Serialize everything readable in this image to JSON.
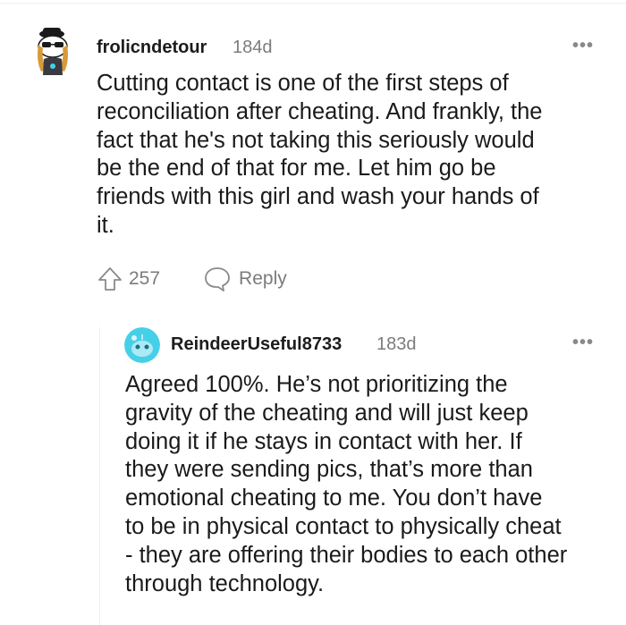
{
  "comment": {
    "username": "frolicndetour",
    "age": "184d",
    "more_label": "•••",
    "body_lines": [
      "Cutting contact is one of the first steps of",
      "reconciliation after cheating. And frankly, the",
      "fact that he's not taking this seriously would",
      "be the end of that for me. Let him go be",
      "friends with this girl and wash your hands of",
      "it."
    ],
    "upvotes": "257",
    "reply_label": "Reply",
    "avatar_icon": "snoo-avatar-sunglasses-icon"
  },
  "reply": {
    "username": "ReindeerUseful8733",
    "age": "183d",
    "more_label": "•••",
    "body_lines": [
      "Agreed 100%. He’s not prioritizing the",
      "gravity of the cheating and will just keep",
      "doing it if he stays in contact with her. If",
      "they were sending pics, that’s more than",
      "emotional cheating to me. You don’t have",
      "to be in physical contact to physically cheat",
      "- they are offering their bodies to each other",
      "through technology."
    ],
    "avatar_icon": "default-snoo-avatar-icon",
    "avatar_color": "#46d0e8"
  },
  "colors": {
    "meta_gray": "#7c7c7c",
    "divider": "#edeff1"
  }
}
